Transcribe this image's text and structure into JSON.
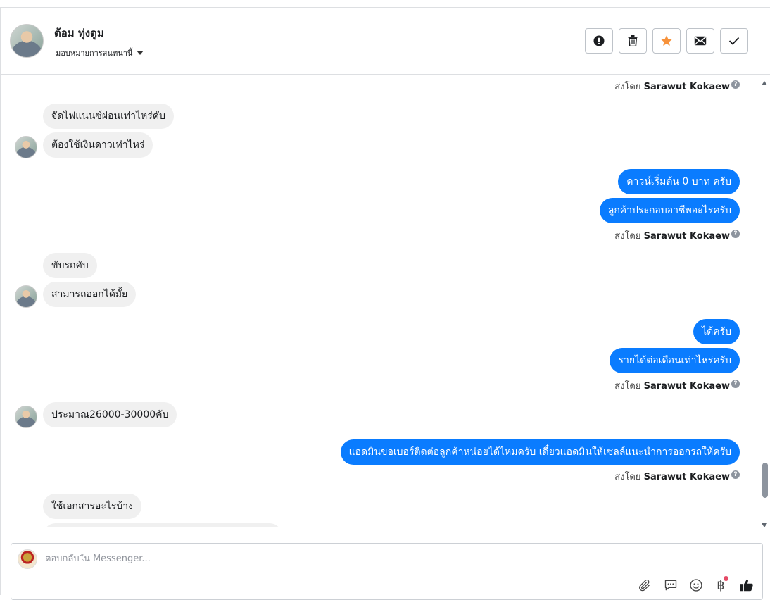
{
  "header": {
    "contact_name": "ต้อม ทุ่งดูม",
    "assign_label": "มอบหมายการสนทนานี้",
    "actions": [
      "spam-icon",
      "trash-icon",
      "star-icon",
      "envelope-icon",
      "check-icon"
    ],
    "star_color": "#f7923a"
  },
  "sentby_prefix": "ส่งโดย",
  "agent_name": "Sarawut Kokaew",
  "messages": {
    "m1": "จัดไฟแนนซ์ผ่อนเท่าไหร่คับ",
    "m2": "ต้องใช้เงินดาวเท่าไหร่",
    "m3": "ดาวน์เริ่มต้น 0 บาท ครับ",
    "m4": "ลูกค้าประกอบอาชีพอะไรครับ",
    "m5": "ขับรถคับ",
    "m6": "สามารถออกได้มั้ย",
    "m7": "ได้ครับ",
    "m8": "รายได้ต่อเดือนเท่าไหร่ครับ",
    "m9": "ประมาณ26000-30000คับ",
    "m10": "แอดมินขอเบอร์ติดต่อลูกค้าหน่อยได้ไหมครับ เดี๋ยวแอดมินให้เซลล์แนะนำการออกรถให้ครับ",
    "m11": "ใช้เอกสารอะไรบ้าง"
  },
  "colors": {
    "outgoing": "#0a7cff",
    "incoming": "#f0f0f0"
  },
  "composer": {
    "placeholder": "ตอบกลับใน Messenger...",
    "tools": [
      "paperclip-icon",
      "quick-reply-icon",
      "emoji-icon",
      "baht-icon",
      "thumbs-up-icon"
    ],
    "baht_symbol": "฿"
  }
}
